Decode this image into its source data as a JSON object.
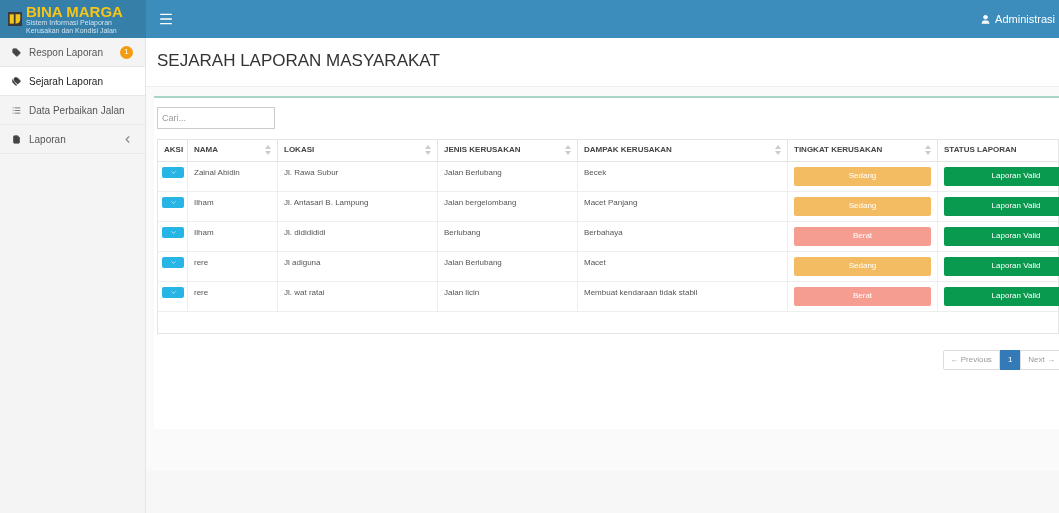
{
  "header": {
    "logo_title": "BINA MARGA",
    "logo_subtitle": "Sistem Informasi Pelaporan Kerusakan dan Kondisi Jalan",
    "user": "Administrasi"
  },
  "sidebar": {
    "items": [
      {
        "label": "Respon Laporan",
        "badge": "1",
        "selected": false,
        "has_submenu": false
      },
      {
        "label": "Sejarah Laporan",
        "selected": true,
        "has_submenu": false
      },
      {
        "label": "Data Perbaikan Jalan",
        "selected": false,
        "has_submenu": false
      },
      {
        "label": "Laporan",
        "selected": false,
        "has_submenu": true
      }
    ]
  },
  "page_title": "SEJARAH LAPORAN MASYARAKAT",
  "search": {
    "placeholder": "Cari..."
  },
  "table": {
    "columns": [
      {
        "label": "AKSI"
      },
      {
        "label": "NAMA"
      },
      {
        "label": "LOKASI"
      },
      {
        "label": "JENIS KERUSAKAN"
      },
      {
        "label": "DAMPAK KERUSAKAN"
      },
      {
        "label": "TINGKAT KERUSAKAN"
      },
      {
        "label": "STATUS LAPORAN"
      }
    ],
    "rows": [
      {
        "nama": "Zainal Abidin",
        "lokasi": "Jl. Rawa Subur",
        "jenis": "Jalan Berlubang",
        "dampak": "Becek",
        "tingkat": "Sedang",
        "color": "#f3bc62",
        "status": "Laporan Valid"
      },
      {
        "nama": "Ilham",
        "lokasi": "Jl. Antasari B. Lampung",
        "jenis": "Jalan bergelombang",
        "dampak": "Macet Panjang",
        "tingkat": "Sedang",
        "color": "#f3bc62",
        "status": "Laporan Valid"
      },
      {
        "nama": "Ilham",
        "lokasi": "Jl. dididididi",
        "jenis": "Berlubang",
        "dampak": "Berbahaya",
        "tingkat": "Berat",
        "color": "#f59d91",
        "status": "Laporan Valid"
      },
      {
        "nama": "rere",
        "lokasi": "Jl adiguna",
        "jenis": "Jalan Berlubang",
        "dampak": "Macet",
        "tingkat": "Sedang",
        "color": "#f3bc62",
        "status": "Laporan Valid"
      },
      {
        "nama": "rere",
        "lokasi": "Jl. wat ratai",
        "jenis": "Jalan licin",
        "dampak": "Membuat kendaraan tidak stabil",
        "tingkat": "Berat",
        "color": "#f59d91",
        "status": "Laporan Valid"
      }
    ]
  },
  "pagination": {
    "previous": "← Previous",
    "pages": [
      {
        "label": "1",
        "selected": true
      }
    ],
    "next": "Next →"
  }
}
